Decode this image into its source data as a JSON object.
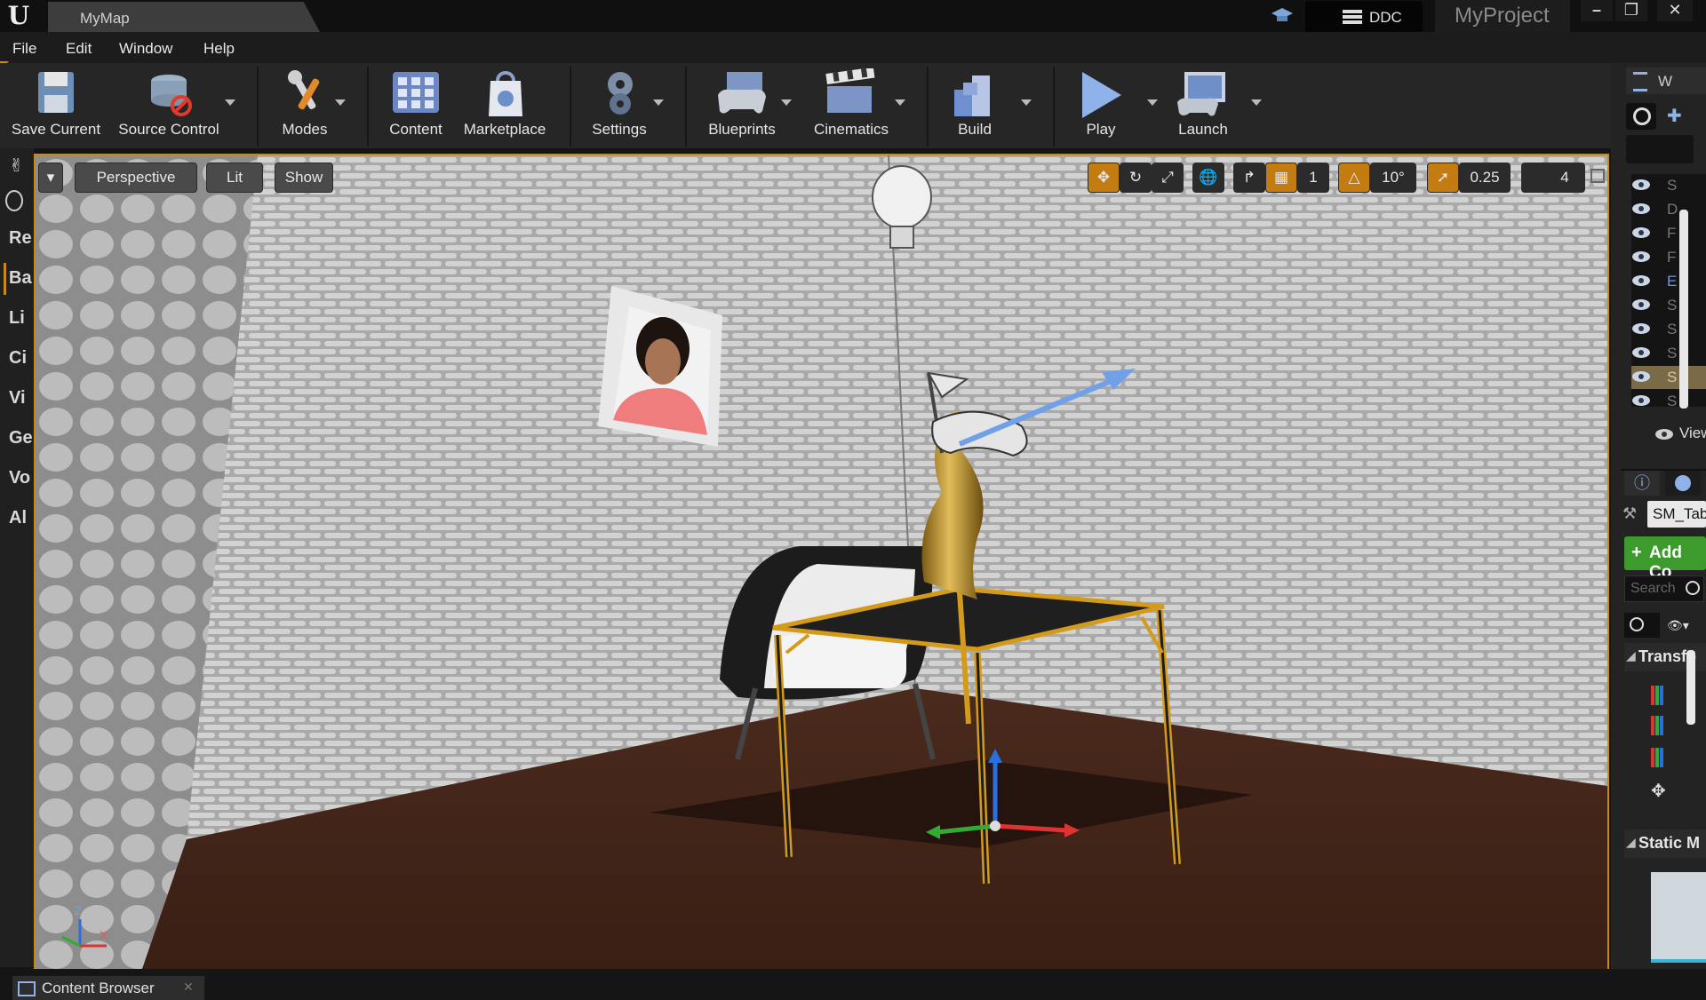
{
  "window": {
    "tab_title": "MyMap",
    "ddc_label": "DDC",
    "project_name": "MyProject"
  },
  "menu": [
    "File",
    "Edit",
    "Window",
    "Help"
  ],
  "toolbar": {
    "save_current": "Save Current",
    "source_control": "Source Control",
    "modes": "Modes",
    "content": "Content",
    "marketplace": "Marketplace",
    "settings": "Settings",
    "blueprints": "Blueprints",
    "cinematics": "Cinematics",
    "build": "Build",
    "play": "Play",
    "launch": "Launch"
  },
  "left_panel": {
    "items": [
      "Re",
      "Ba",
      "Li",
      "Ci",
      "Vi",
      "Ge",
      "Vo",
      "Al"
    ]
  },
  "viewport": {
    "view_mode": "Perspective",
    "lighting": "Lit",
    "show": "Show",
    "grid_snap": "1",
    "rotation_snap": "10°",
    "scale_snap": "0.25",
    "camera_speed": "4",
    "axis_x": "X",
    "axis_z": "Z"
  },
  "world_outliner": {
    "tab_label": "W",
    "rows": [
      "S",
      "D",
      "F",
      "F",
      "E",
      "S",
      "S",
      "S",
      "S",
      "S"
    ],
    "view_options": "View"
  },
  "details": {
    "actor_name": "SM_Tab",
    "add_component": "Add Co",
    "search_placeholder": "Search",
    "transform_section": "Transfo",
    "static_mesh_section": "Static M"
  },
  "bottom": {
    "content_browser": "Content Browser"
  },
  "colors": {
    "accent_orange": "#c88a13",
    "add_green": "#3c9b2c"
  }
}
